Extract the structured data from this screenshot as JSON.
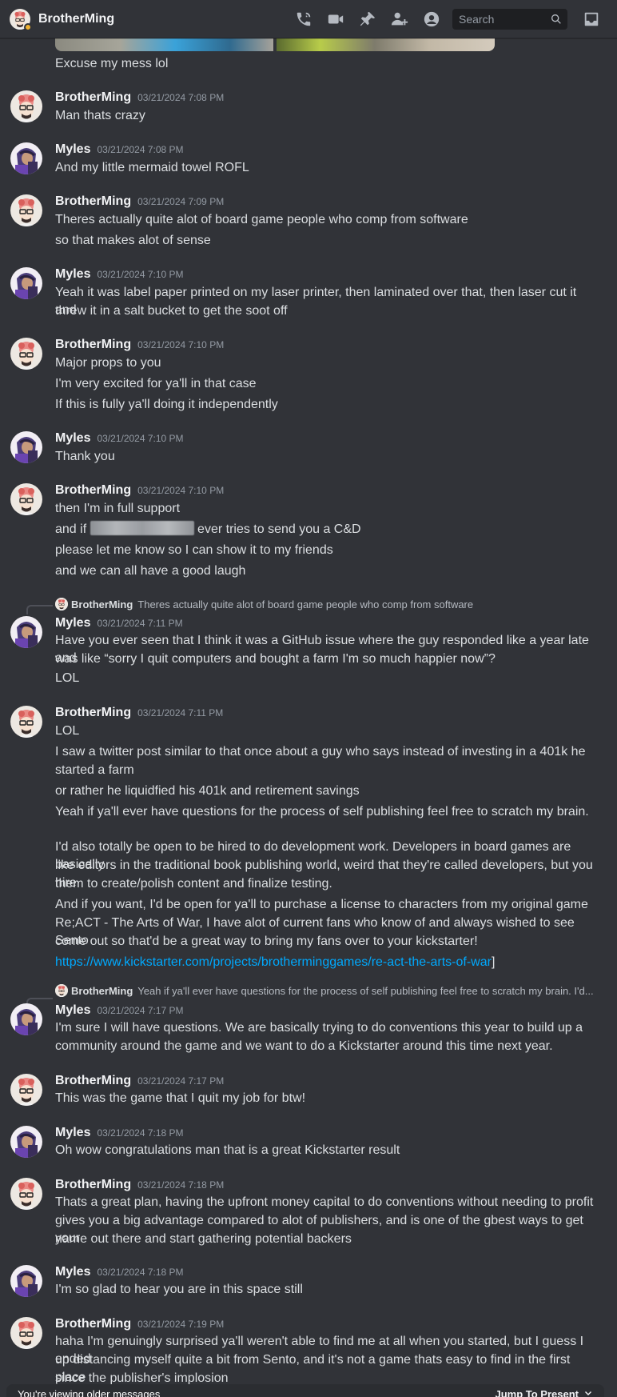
{
  "header": {
    "title": "BrotherMing",
    "search_placeholder": "Search",
    "icons": [
      "phone-call-icon",
      "video-call-icon",
      "pin-icon",
      "add-friends-icon",
      "user-profile-icon",
      "search-icon",
      "inbox-icon"
    ]
  },
  "attachment_caption": "Excuse my mess lol",
  "messages": [
    {
      "author": "BrotherMing",
      "timestamp": "03/21/2024 7:08 PM",
      "lines": [
        "Man thats crazy"
      ]
    },
    {
      "author": "Myles",
      "timestamp": "03/21/2024 7:08 PM",
      "lines": [
        "And my little mermaid towel ROFL"
      ]
    },
    {
      "author": "BrotherMing",
      "timestamp": "03/21/2024 7:09 PM",
      "lines": [
        "Theres actually quite alot of board game people who comp from software",
        "so that makes alot of sense"
      ]
    },
    {
      "author": "Myles",
      "timestamp": "03/21/2024 7:10 PM",
      "lines": [
        "Yeah it was label paper printed on my laser printer, then laminated over that, then laser cut it and",
        "threw it in a salt bucket to get the soot off"
      ]
    },
    {
      "author": "BrotherMing",
      "timestamp": "03/21/2024 7:10 PM",
      "lines": [
        "Major props to you",
        "I'm very excited for ya'll in that case",
        "If this is fully ya'll doing it independently"
      ]
    },
    {
      "author": "Myles",
      "timestamp": "03/21/2024 7:10 PM",
      "lines": [
        "Thank you"
      ]
    },
    {
      "author": "BrotherMing",
      "timestamp": "03/21/2024 7:10 PM",
      "lines": [
        "then I'm in full support",
        "and if",
        "ever tries to send you a C&D",
        "please let me know so I can show it to my friends",
        "and we can all have a good laugh"
      ]
    },
    {
      "reply_to": {
        "author": "BrotherMing",
        "text": "Theres actually quite alot of board game people who comp from software"
      },
      "author": "Myles",
      "timestamp": "03/21/2024 7:11 PM",
      "lines": [
        "Have you ever seen that I think it was a GitHub issue where the guy responded like a year late and",
        "was like “sorry I quit computers and bought a farm I'm so much happier now”?",
        "LOL"
      ]
    },
    {
      "author": "BrotherMing",
      "timestamp": "03/21/2024 7:11 PM",
      "lines": [
        "LOL",
        "I saw a twitter post similar to that once about a guy who says instead of investing in a 401k he",
        "started a farm",
        "or rather he liquidfied his 401k and retirement savings",
        "Yeah if ya'll ever have questions for the process of self publishing feel free to scratch my brain.",
        "I'd also totally be open to be hired to do development work. Developers in board games are basically",
        "like editors in the traditional book publishing world, weird that they're called developers, but you hire",
        "them to create/polish content and finalize testing.",
        "And if you want, I'd be open for ya'll to purchase a license to characters from my original game",
        "Re;ACT - The Arts of War, I have alot of current fans who know of and always wished to see Sento",
        "come out so that'd be a great way to bring my fans over to your kickstarter!",
        "https://www.kickstarter.com/projects/brotherminggames/re-act-the-arts-of-war",
        "]"
      ]
    },
    {
      "reply_to": {
        "author": "BrotherMing",
        "text": "Yeah if ya'll ever have questions for the process of self publishing feel free to scratch my brain.  I'd..."
      },
      "author": "Myles",
      "timestamp": "03/21/2024 7:17 PM",
      "lines": [
        "I'm sure I will have questions. We are basically trying to do conventions this year to build up a",
        "community around the game and we want to do a Kickstarter around this time next year."
      ]
    },
    {
      "author": "BrotherMing",
      "timestamp": "03/21/2024 7:17 PM",
      "lines": [
        "This was the game that I quit my job for btw!"
      ]
    },
    {
      "author": "Myles",
      "timestamp": "03/21/2024 7:18 PM",
      "lines": [
        "Oh wow congratulations man that is a great Kickstarter result"
      ]
    },
    {
      "author": "BrotherMing",
      "timestamp": "03/21/2024 7:18 PM",
      "lines": [
        "Thats a great plan, having the upfront money capital to do conventions without needing to profit",
        "gives you a big advantage compared to alot of publishers, and is one of the gbest ways to get your",
        "name out there and start gathering potential backers"
      ]
    },
    {
      "author": "Myles",
      "timestamp": "03/21/2024 7:18 PM",
      "lines": [
        "I'm so glad to hear you are in this space still"
      ]
    },
    {
      "author": "BrotherMing",
      "timestamp": "03/21/2024 7:19 PM",
      "lines": [
        "haha I'm genuingly surprised ya'll weren't able to find me at all when you started, but I guess I ended",
        "up distancing myself quite a bit from Sento, and it's not a game thats easy to find in the first place",
        "since the publisher's implosion"
      ]
    }
  ],
  "footer": {
    "older_text": "You're viewing older messages",
    "jump_label": "Jump To Present"
  },
  "colors": {
    "background": "#313338",
    "text": "#dbdee1",
    "link": "#00a8fc",
    "timestamp": "#949ba4"
  }
}
